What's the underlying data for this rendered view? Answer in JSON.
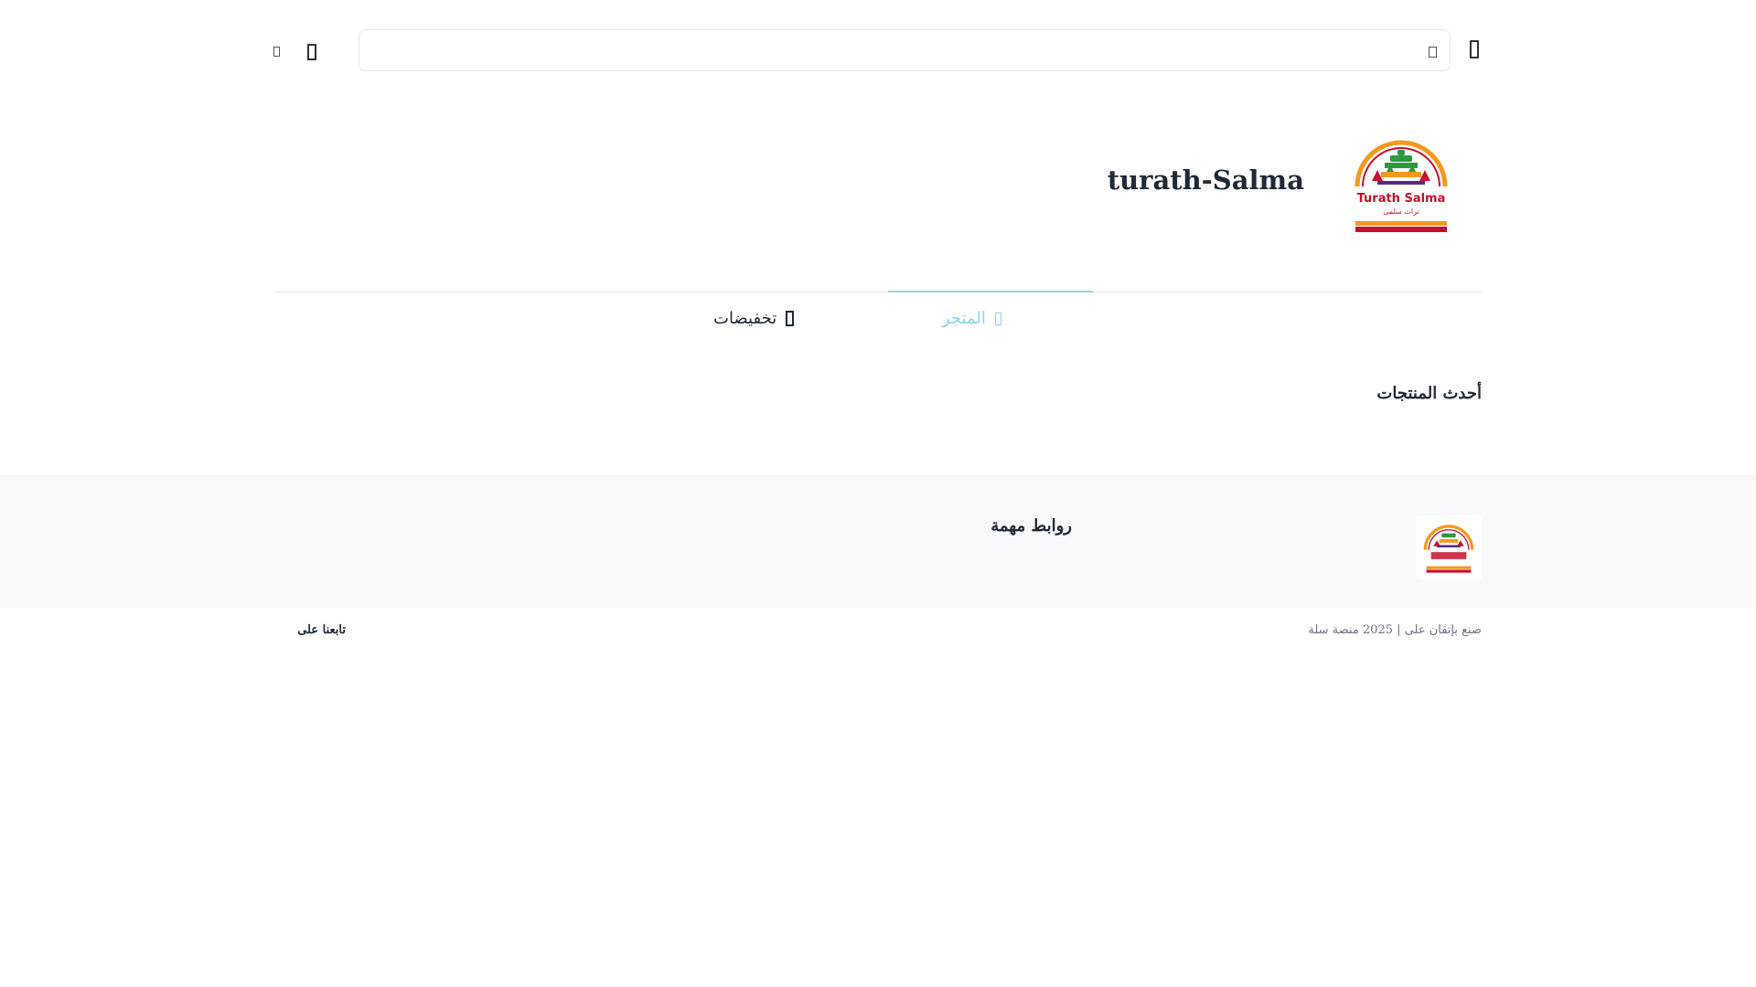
{
  "header": {
    "search_placeholder": "",
    "icons": [
      "menu-icon",
      "search-icon",
      "cart-icon",
      "user-icon"
    ]
  },
  "brand": {
    "store_name": "turath-Salma",
    "logo_text_en": "Turath Salma",
    "logo_text_ar": "تراث سلمى",
    "colors": {
      "red": "#c8102e",
      "orange": "#f39a1e",
      "green": "#2e9a3e",
      "purple": "#5b2a86"
    }
  },
  "nav": {
    "items": [
      {
        "label": "المتجر",
        "active": true
      },
      {
        "label": "تخفيضات",
        "active": false
      }
    ],
    "active_color": "#8fd3e2"
  },
  "main": {
    "section_title": "أحدث المنتجات"
  },
  "footer": {
    "links_title": "روابط مهمة",
    "copyright": "صنع بإتقان على | 2025 منصة سلة",
    "follow_label": "تابعنا على"
  }
}
